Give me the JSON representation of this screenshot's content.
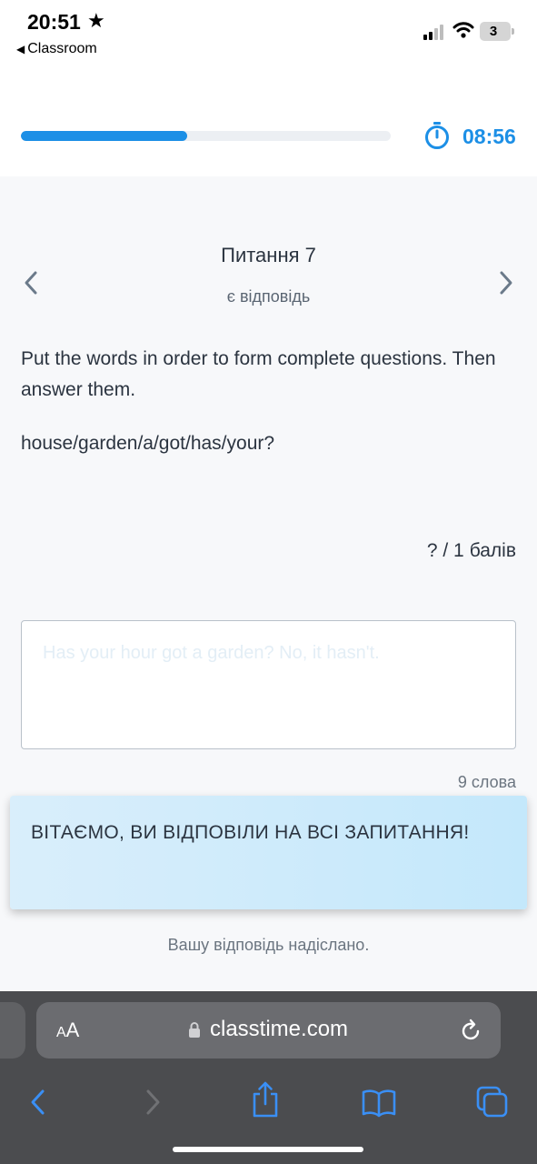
{
  "status_bar": {
    "time": "20:51",
    "back_label": "Classroom",
    "battery": "3"
  },
  "header": {
    "progress_fraction": 0.45,
    "timer": "08:56",
    "accent_color": "#1c8fe6"
  },
  "question": {
    "title": "Питання 7",
    "status": "є відповідь",
    "instruction": "Put the words in order to form complete questions. Then answer them.",
    "prompt": "house/garden/a/got/has/your?",
    "points_value": "? / 1",
    "points_unit": "балів"
  },
  "answer": {
    "text": "Has your hour got a garden? No, it hasn't.",
    "word_count": "9 слова"
  },
  "toast": {
    "message": "ВІТАЄМО, ВИ ВІДПОВІЛИ НА ВСІ ЗАПИТАННЯ!"
  },
  "submitted_text": "Вашу відповідь надіслано.",
  "browser": {
    "aa_small": "A",
    "aa_large": "A",
    "url": "classtime.com",
    "icons": [
      "back-icon",
      "forward-icon",
      "share-icon",
      "bookmarks-icon",
      "tabs-icon",
      "lock-icon",
      "reload-icon"
    ]
  }
}
